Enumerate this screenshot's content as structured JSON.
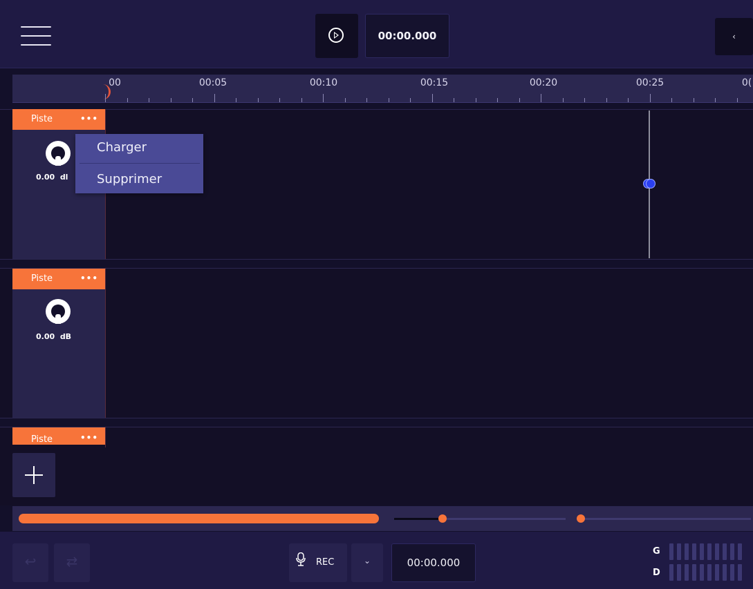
{
  "toolbar": {
    "menu_icon": "hamburger-icon",
    "play_icon": "play-circle-icon",
    "time": "00:00.000",
    "collapse_label": "‹"
  },
  "ruler": {
    "labels": [
      "00",
      "00:05",
      "00:10",
      "00:15",
      "00:20",
      "00:25",
      "0("
    ]
  },
  "tracks": [
    {
      "name": "Piste",
      "menu_label": "•••",
      "gain": "0.00",
      "unit": "dl"
    },
    {
      "name": "Piste",
      "menu_label": "•••",
      "gain": "0.00",
      "unit": "dB"
    },
    {
      "name": "Piste",
      "menu_label": "•••"
    }
  ],
  "context_menu": {
    "items": [
      "Charger",
      "Supprimer"
    ]
  },
  "add_track": {
    "icon": "plus-icon"
  },
  "transport": {
    "undo_icon": "undo-icon",
    "redo_icon": "redo-icon",
    "rec_label": "REC",
    "rec_dropdown_label": "⌄",
    "time": "00:00.000"
  },
  "meters": {
    "left_label": "G",
    "right_label": "D"
  },
  "colors": {
    "accent": "#f7743a",
    "panel": "#28244c",
    "background": "#13102a",
    "menu": "#4a4a96"
  }
}
